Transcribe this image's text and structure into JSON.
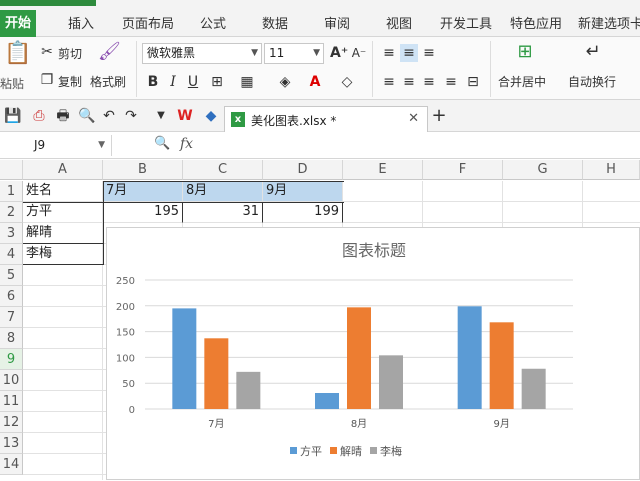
{
  "ribbon_tabs": [
    "开始",
    "插入",
    "页面布局",
    "公式",
    "数据",
    "审阅",
    "视图",
    "开发工具",
    "特色应用",
    "新建选项卡"
  ],
  "ribbon": {
    "cut": "剪切",
    "copy": "复制",
    "paste": "粘贴",
    "format_painter": "格式刷",
    "font_name": "微软雅黑",
    "font_size": "11",
    "merge_center": "合并居中",
    "wrap_text": "自动换行"
  },
  "doc_tab": {
    "filename": "美化图表.xlsx *"
  },
  "formula_bar": {
    "cell_ref": "J9",
    "fx": "fx"
  },
  "columns": [
    "A",
    "B",
    "C",
    "D",
    "E",
    "F",
    "G",
    "H"
  ],
  "rows": [
    "1",
    "2",
    "3",
    "4",
    "5",
    "6",
    "7",
    "8",
    "9",
    "10",
    "11",
    "12",
    "13",
    "14"
  ],
  "cells": {
    "A1": "姓名",
    "B1": "7月",
    "C1": "8月",
    "D1": "9月",
    "A2": "方平",
    "B2": "195",
    "C2": "31",
    "D2": "199",
    "A3": "解晴",
    "A4": "李梅"
  },
  "colors": {
    "series1": "#5b9bd5",
    "series2": "#ed7d31",
    "series3": "#a5a5a5",
    "accent": "#2f9a44"
  },
  "chart_data": {
    "type": "bar",
    "title": "图表标题",
    "categories": [
      "7月",
      "8月",
      "9月"
    ],
    "series": [
      {
        "name": "方平",
        "values": [
          195,
          31,
          199
        ]
      },
      {
        "name": "解晴",
        "values": [
          137,
          197,
          168
        ]
      },
      {
        "name": "李梅",
        "values": [
          72,
          104,
          78
        ]
      }
    ],
    "yticks": [
      "0",
      "50",
      "100",
      "150",
      "200",
      "250"
    ],
    "ylim": [
      0,
      250
    ],
    "grid": true,
    "legend_position": "bottom"
  }
}
